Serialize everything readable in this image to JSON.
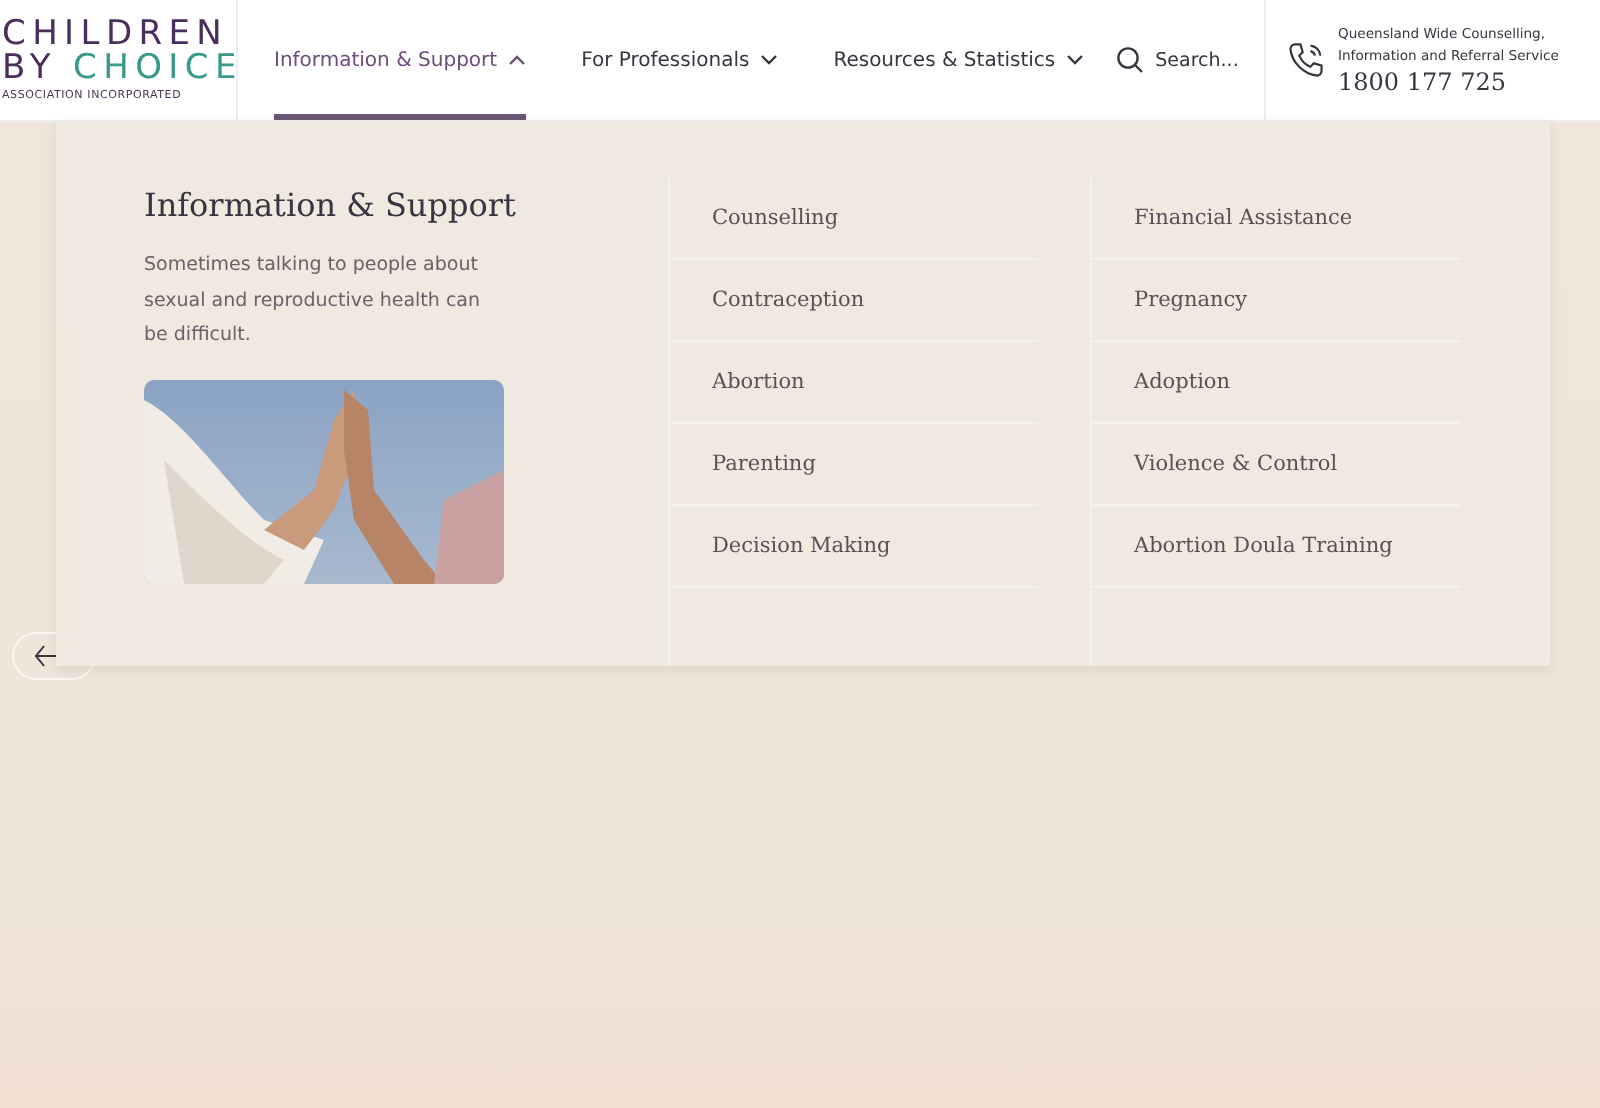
{
  "logo": {
    "line_1": "CHILDREN",
    "line_2_a": "BY",
    "line_2_b": "CHOICE",
    "line_3": "ASSOCIATION INCORPORATED"
  },
  "nav": [
    {
      "label": "Information & Support",
      "selected": true,
      "expanded": true
    },
    {
      "label": "For Professionals",
      "selected": false,
      "expanded": false
    },
    {
      "label": "Resources & Statistics",
      "selected": false,
      "expanded": false
    }
  ],
  "search": {
    "placeholder": "Search..."
  },
  "helpline": {
    "caption": "Queensland Wide Counselling, Information and Referral Service",
    "phone": "1800 177 725"
  },
  "menu": {
    "title": "Information & Support",
    "description": "Sometimes talking to people about sexual and reproductive health can be difficult.",
    "columns": [
      [
        "Counselling",
        "Contraception",
        "Abortion",
        "Parenting",
        "Decision Making"
      ],
      [
        "Financial Assistance",
        "Pregnancy",
        "Adoption",
        "Violence & Control",
        "Abortion Doula Training"
      ]
    ]
  }
}
